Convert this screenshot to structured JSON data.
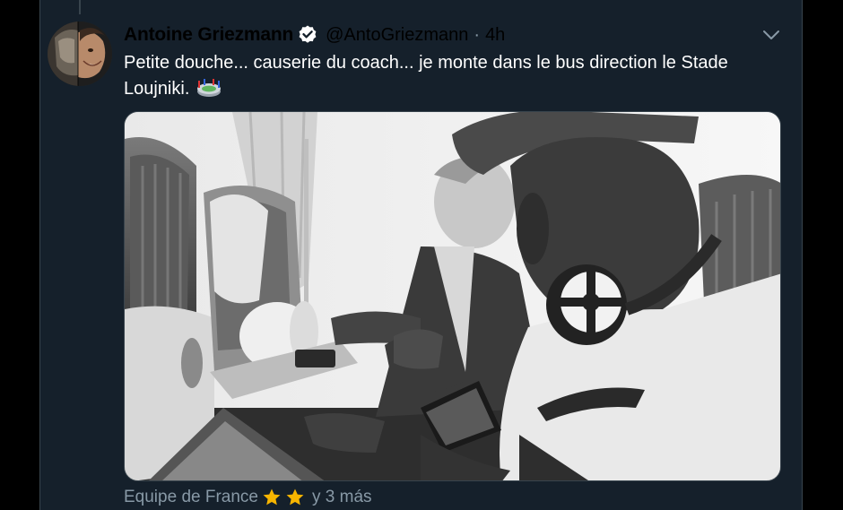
{
  "tweet": {
    "display_name": "Antoine Griezmann",
    "handle": "@AntoGriezmann",
    "separator": "·",
    "time": "4h",
    "text": "Petite douche... causerie du coach... je monte dans le bus direction le Stade Loujniki."
  },
  "footer": {
    "team_label": "Equipe de France",
    "more_label": "y 3 más"
  },
  "icons": {
    "verified": "verified-badge-icon",
    "caret": "chevron-down-icon",
    "stadium": "stadium-emoji-icon",
    "star": "star-icon"
  },
  "colors": {
    "background": "#15202b",
    "text": "#ffffff",
    "secondary_text": "#8899a6",
    "border": "#38444d",
    "accent": "#1da1f2",
    "star": "#f7b500"
  }
}
